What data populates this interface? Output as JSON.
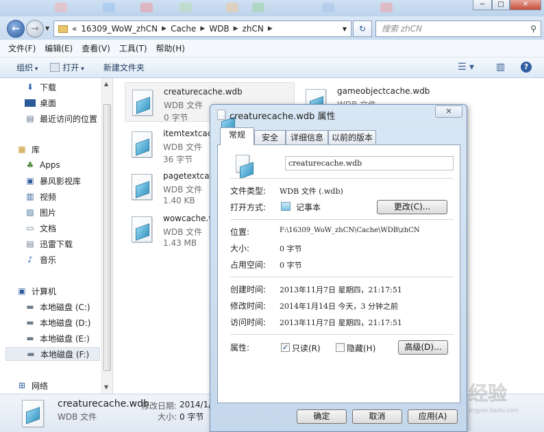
{
  "address": {
    "overflow": "«",
    "segments": [
      "16309_WoW_zhCN",
      "Cache",
      "WDB",
      "zhCN"
    ],
    "search_placeholder": "搜索 zhCN"
  },
  "menu": [
    "文件(F)",
    "编辑(E)",
    "查看(V)",
    "工具(T)",
    "帮助(H)"
  ],
  "toolbar": {
    "organize": "组织",
    "open": "打开",
    "new_folder": "新建文件夹"
  },
  "nav": {
    "favorites": [
      "下载",
      "桌面",
      "最近访问的位置"
    ],
    "library_header": "库",
    "library": [
      "Apps",
      "暴风影视库",
      "视频",
      "图片",
      "文档",
      "迅雷下载",
      "音乐"
    ],
    "computer_header": "计算机",
    "drives": [
      "本地磁盘 (C:)",
      "本地磁盘 (D:)",
      "本地磁盘 (E:)",
      "本地磁盘 (F:)"
    ],
    "network": "网络"
  },
  "files": [
    {
      "name": "creaturecache.wdb",
      "type": "WDB 文件",
      "size": "0 字节"
    },
    {
      "name": "gameobjectcache.wdb",
      "type": "WDB 文件"
    },
    {
      "name": "itemtextcache",
      "type": "WDB 文件",
      "size": "36 字节"
    },
    {
      "name": "pagetextcac",
      "type": "WDB 文件",
      "size": "1.40 KB"
    },
    {
      "name": "wowcache.w",
      "type": "WDB 文件",
      "size": "1.43 MB"
    }
  ],
  "details": {
    "name": "creaturecache.wdb",
    "type": "WDB 文件",
    "modified_label": "修改日期:",
    "modified_value": "2014/1/",
    "size_label": "大小:",
    "size_value": "0 字节"
  },
  "dialog": {
    "title": "creaturecache.wdb 属性",
    "close": "✕",
    "tabs": [
      "常规",
      "安全",
      "详细信息",
      "以前的版本"
    ],
    "filename": "creaturecache.wdb",
    "file_type_label": "文件类型:",
    "file_type_value": "WDB 文件 (.wdb)",
    "open_with_label": "打开方式:",
    "open_with_value": "记事本",
    "change_button": "更改(C)...",
    "location_label": "位置:",
    "location_value": "F:\\16309_WoW_zhCN\\Cache\\WDB\\zhCN",
    "size_label": "大小:",
    "size_value": "0 字节",
    "size_on_disk_label": "占用空间:",
    "size_on_disk_value": "0 字节",
    "created_label": "创建时间:",
    "created_value": "2013年11月7日 星期四，21:17:51",
    "modified_label": "修改时间:",
    "modified_value": "2014年1月14日 今天，3 分钟之前",
    "accessed_label": "访问时间:",
    "accessed_value": "2013年11月7日 星期四，21:17:51",
    "attributes_label": "属性:",
    "readonly_label": "只读(R)",
    "readonly_checked": true,
    "hidden_label": "隐藏(H)",
    "hidden_checked": false,
    "advanced_button": "高级(D)...",
    "ok": "确定",
    "cancel": "取消",
    "apply": "应用(A)"
  },
  "watermark": {
    "brand": "Bai",
    "brand2": "经验",
    "sub": "jingyan.baidu.com"
  },
  "colors": {
    "accent": "#2d5d9f",
    "chrome": "#c7dbf0"
  }
}
